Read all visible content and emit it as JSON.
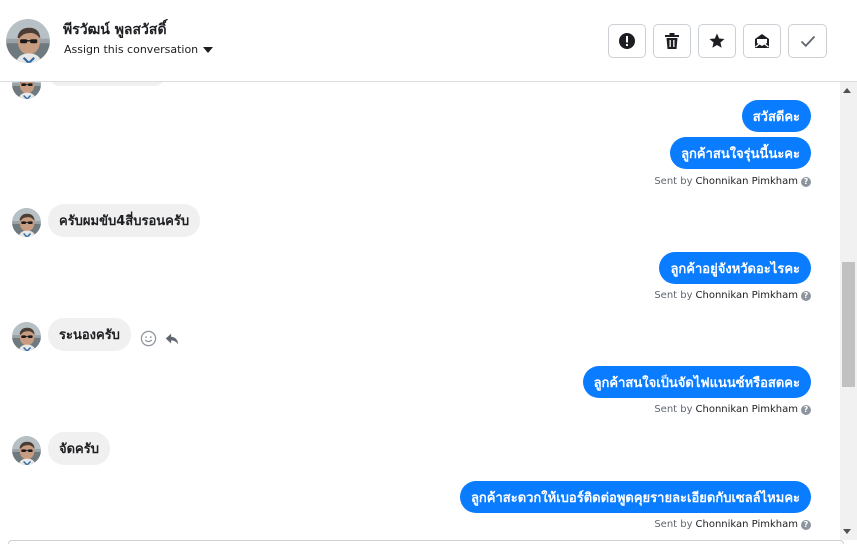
{
  "header": {
    "contact_name": "พีรวัฒน์ พูลสวัสดิ์",
    "assign_label": "Assign this conversation",
    "actions": [
      {
        "name": "mark-spam-button",
        "icon": "exclamation-icon"
      },
      {
        "name": "delete-button",
        "icon": "trash-icon"
      },
      {
        "name": "star-button",
        "icon": "star-icon"
      },
      {
        "name": "mark-unread-button",
        "icon": "envelope-icon"
      },
      {
        "name": "mark-done-button",
        "icon": "check-icon"
      }
    ]
  },
  "messages": {
    "out_1": "สวัสดีคะ",
    "out_2": "ลูกค้าสนใจรุ่นนี้นะคะ",
    "in_1": "ครับผมขับ4สี่บรอนครับ",
    "out_3": "ลูกค้าอยู่จังหวัดอะไรคะ",
    "in_2": "ระนองครับ",
    "out_4": "ลูกค้าสนใจเป็นจัดไฟแนนซ์หรือสดคะ",
    "in_3": "จัดครับ",
    "out_5": "ลูกค้าสะดวกให้เบอร์ติดต่อพูดคุยรายละเอียดกับเซลล์ไหมคะ"
  },
  "sent_by": {
    "prefix": "Sent by",
    "agent": "Chonnikan Pimkham",
    "help_glyph": "?"
  },
  "colors": {
    "outgoing_bubble": "#0a7cff",
    "incoming_bubble": "#f1f0f0",
    "text_primary": "#1c1e21",
    "text_secondary": "#606770"
  },
  "icons": {
    "react": "smiley-icon",
    "reply": "reply-icon"
  }
}
